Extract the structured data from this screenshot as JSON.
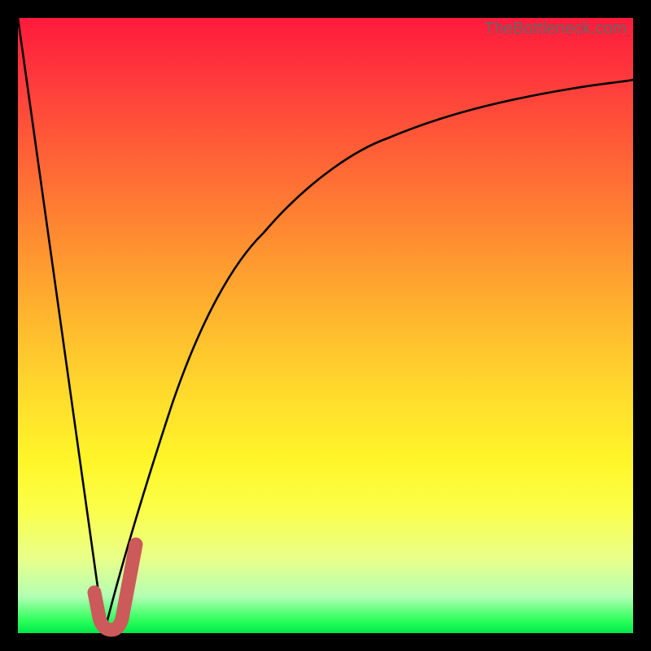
{
  "watermark": "TheBottleneck.com",
  "colors": {
    "frame": "#000000",
    "curve": "#000000",
    "highlight": "#cc5a5a",
    "gradient_top": "#ff1a3c",
    "gradient_bottom": "#00e84a"
  },
  "chart_data": {
    "type": "line",
    "title": "",
    "xlabel": "",
    "ylabel": "",
    "xlim": [
      0,
      100
    ],
    "ylim": [
      0,
      100
    ],
    "series": [
      {
        "name": "left-slope",
        "x": [
          0,
          14
        ],
        "y": [
          100,
          0
        ]
      },
      {
        "name": "saturating-curve",
        "x": [
          14,
          17,
          20,
          25,
          30,
          35,
          40,
          50,
          60,
          70,
          80,
          90,
          100
        ],
        "y": [
          0,
          12,
          22,
          37,
          49,
          58,
          65,
          74,
          80,
          84,
          86.5,
          88.5,
          90
        ]
      },
      {
        "name": "highlight-J",
        "x": [
          12.5,
          13.2,
          14.0,
          15.2,
          16.5,
          18.0,
          19.2
        ],
        "y": [
          6.5,
          2.5,
          0.5,
          0.5,
          4.0,
          9.5,
          14.5
        ]
      }
    ]
  }
}
